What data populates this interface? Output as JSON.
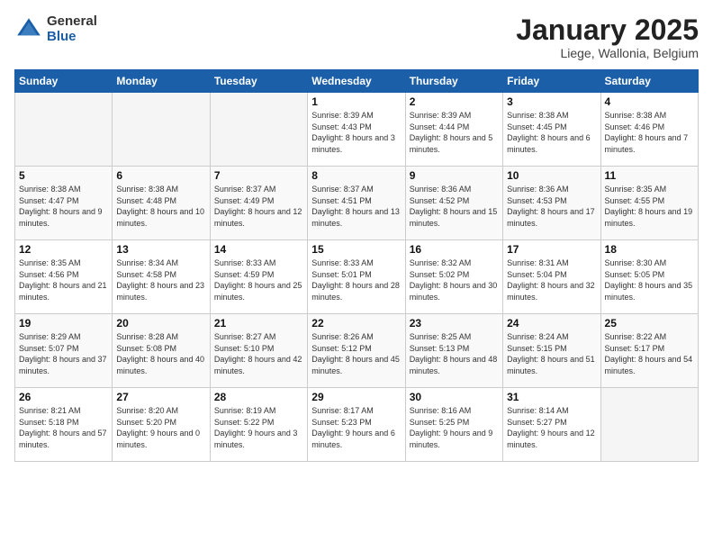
{
  "logo": {
    "general": "General",
    "blue": "Blue"
  },
  "header": {
    "month": "January 2025",
    "location": "Liege, Wallonia, Belgium"
  },
  "weekdays": [
    "Sunday",
    "Monday",
    "Tuesday",
    "Wednesday",
    "Thursday",
    "Friday",
    "Saturday"
  ],
  "weeks": [
    [
      {
        "day": "",
        "sunrise": "",
        "sunset": "",
        "daylight": ""
      },
      {
        "day": "",
        "sunrise": "",
        "sunset": "",
        "daylight": ""
      },
      {
        "day": "",
        "sunrise": "",
        "sunset": "",
        "daylight": ""
      },
      {
        "day": "1",
        "sunrise": "Sunrise: 8:39 AM",
        "sunset": "Sunset: 4:43 PM",
        "daylight": "Daylight: 8 hours and 3 minutes."
      },
      {
        "day": "2",
        "sunrise": "Sunrise: 8:39 AM",
        "sunset": "Sunset: 4:44 PM",
        "daylight": "Daylight: 8 hours and 5 minutes."
      },
      {
        "day": "3",
        "sunrise": "Sunrise: 8:38 AM",
        "sunset": "Sunset: 4:45 PM",
        "daylight": "Daylight: 8 hours and 6 minutes."
      },
      {
        "day": "4",
        "sunrise": "Sunrise: 8:38 AM",
        "sunset": "Sunset: 4:46 PM",
        "daylight": "Daylight: 8 hours and 7 minutes."
      }
    ],
    [
      {
        "day": "5",
        "sunrise": "Sunrise: 8:38 AM",
        "sunset": "Sunset: 4:47 PM",
        "daylight": "Daylight: 8 hours and 9 minutes."
      },
      {
        "day": "6",
        "sunrise": "Sunrise: 8:38 AM",
        "sunset": "Sunset: 4:48 PM",
        "daylight": "Daylight: 8 hours and 10 minutes."
      },
      {
        "day": "7",
        "sunrise": "Sunrise: 8:37 AM",
        "sunset": "Sunset: 4:49 PM",
        "daylight": "Daylight: 8 hours and 12 minutes."
      },
      {
        "day": "8",
        "sunrise": "Sunrise: 8:37 AM",
        "sunset": "Sunset: 4:51 PM",
        "daylight": "Daylight: 8 hours and 13 minutes."
      },
      {
        "day": "9",
        "sunrise": "Sunrise: 8:36 AM",
        "sunset": "Sunset: 4:52 PM",
        "daylight": "Daylight: 8 hours and 15 minutes."
      },
      {
        "day": "10",
        "sunrise": "Sunrise: 8:36 AM",
        "sunset": "Sunset: 4:53 PM",
        "daylight": "Daylight: 8 hours and 17 minutes."
      },
      {
        "day": "11",
        "sunrise": "Sunrise: 8:35 AM",
        "sunset": "Sunset: 4:55 PM",
        "daylight": "Daylight: 8 hours and 19 minutes."
      }
    ],
    [
      {
        "day": "12",
        "sunrise": "Sunrise: 8:35 AM",
        "sunset": "Sunset: 4:56 PM",
        "daylight": "Daylight: 8 hours and 21 minutes."
      },
      {
        "day": "13",
        "sunrise": "Sunrise: 8:34 AM",
        "sunset": "Sunset: 4:58 PM",
        "daylight": "Daylight: 8 hours and 23 minutes."
      },
      {
        "day": "14",
        "sunrise": "Sunrise: 8:33 AM",
        "sunset": "Sunset: 4:59 PM",
        "daylight": "Daylight: 8 hours and 25 minutes."
      },
      {
        "day": "15",
        "sunrise": "Sunrise: 8:33 AM",
        "sunset": "Sunset: 5:01 PM",
        "daylight": "Daylight: 8 hours and 28 minutes."
      },
      {
        "day": "16",
        "sunrise": "Sunrise: 8:32 AM",
        "sunset": "Sunset: 5:02 PM",
        "daylight": "Daylight: 8 hours and 30 minutes."
      },
      {
        "day": "17",
        "sunrise": "Sunrise: 8:31 AM",
        "sunset": "Sunset: 5:04 PM",
        "daylight": "Daylight: 8 hours and 32 minutes."
      },
      {
        "day": "18",
        "sunrise": "Sunrise: 8:30 AM",
        "sunset": "Sunset: 5:05 PM",
        "daylight": "Daylight: 8 hours and 35 minutes."
      }
    ],
    [
      {
        "day": "19",
        "sunrise": "Sunrise: 8:29 AM",
        "sunset": "Sunset: 5:07 PM",
        "daylight": "Daylight: 8 hours and 37 minutes."
      },
      {
        "day": "20",
        "sunrise": "Sunrise: 8:28 AM",
        "sunset": "Sunset: 5:08 PM",
        "daylight": "Daylight: 8 hours and 40 minutes."
      },
      {
        "day": "21",
        "sunrise": "Sunrise: 8:27 AM",
        "sunset": "Sunset: 5:10 PM",
        "daylight": "Daylight: 8 hours and 42 minutes."
      },
      {
        "day": "22",
        "sunrise": "Sunrise: 8:26 AM",
        "sunset": "Sunset: 5:12 PM",
        "daylight": "Daylight: 8 hours and 45 minutes."
      },
      {
        "day": "23",
        "sunrise": "Sunrise: 8:25 AM",
        "sunset": "Sunset: 5:13 PM",
        "daylight": "Daylight: 8 hours and 48 minutes."
      },
      {
        "day": "24",
        "sunrise": "Sunrise: 8:24 AM",
        "sunset": "Sunset: 5:15 PM",
        "daylight": "Daylight: 8 hours and 51 minutes."
      },
      {
        "day": "25",
        "sunrise": "Sunrise: 8:22 AM",
        "sunset": "Sunset: 5:17 PM",
        "daylight": "Daylight: 8 hours and 54 minutes."
      }
    ],
    [
      {
        "day": "26",
        "sunrise": "Sunrise: 8:21 AM",
        "sunset": "Sunset: 5:18 PM",
        "daylight": "Daylight: 8 hours and 57 minutes."
      },
      {
        "day": "27",
        "sunrise": "Sunrise: 8:20 AM",
        "sunset": "Sunset: 5:20 PM",
        "daylight": "Daylight: 9 hours and 0 minutes."
      },
      {
        "day": "28",
        "sunrise": "Sunrise: 8:19 AM",
        "sunset": "Sunset: 5:22 PM",
        "daylight": "Daylight: 9 hours and 3 minutes."
      },
      {
        "day": "29",
        "sunrise": "Sunrise: 8:17 AM",
        "sunset": "Sunset: 5:23 PM",
        "daylight": "Daylight: 9 hours and 6 minutes."
      },
      {
        "day": "30",
        "sunrise": "Sunrise: 8:16 AM",
        "sunset": "Sunset: 5:25 PM",
        "daylight": "Daylight: 9 hours and 9 minutes."
      },
      {
        "day": "31",
        "sunrise": "Sunrise: 8:14 AM",
        "sunset": "Sunset: 5:27 PM",
        "daylight": "Daylight: 9 hours and 12 minutes."
      },
      {
        "day": "",
        "sunrise": "",
        "sunset": "",
        "daylight": ""
      }
    ]
  ]
}
